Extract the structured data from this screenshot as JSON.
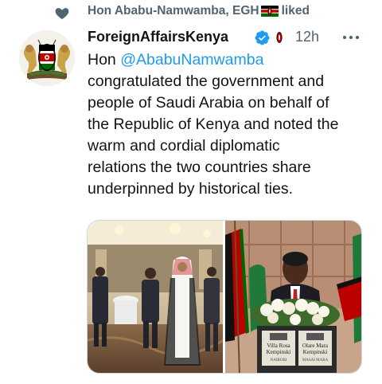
{
  "social_context": {
    "liker_name": "Hon Ababu-Namwamba, EGH",
    "action": "liked",
    "heart_icon": "heart-filled-icon",
    "flag_icon": "kenya-flag-emoji"
  },
  "tweet": {
    "author_name": "ForeignAffairsKenya",
    "verified_icon": "verified-badge-icon",
    "verified_color": "#1d9bf0",
    "timestamp": "12h",
    "more_icon": "more-horizontal-icon",
    "avatar_icon": "kenya-coat-of-arms-logo",
    "text_prefix": "Hon ",
    "mention": "@AbabuNamwamba",
    "text_lines": [
      "congratulated the government and",
      "people of Saudi Arabia on behalf of",
      "the Republic of Kenya and noted the",
      "warm  and cordial  diplomatic",
      "relations the two countries share",
      "underpinned by historical ties."
    ],
    "media": [
      {
        "name": "reception-photo",
        "description_icon": "photo"
      },
      {
        "name": "podium-photo",
        "description_icon": "photo"
      }
    ],
    "podium_sign": {
      "left_brand": "Villa Rosa",
      "left_brand_2": "Kempinski",
      "left_city": "NAIROBI",
      "right_brand": "Olare Mara",
      "right_brand_2": "Kempinski",
      "right_city": "MASAI MARA"
    }
  },
  "colors": {
    "text_primary": "#0f1419",
    "text_secondary": "#536471",
    "link": "#1d9bf0"
  }
}
